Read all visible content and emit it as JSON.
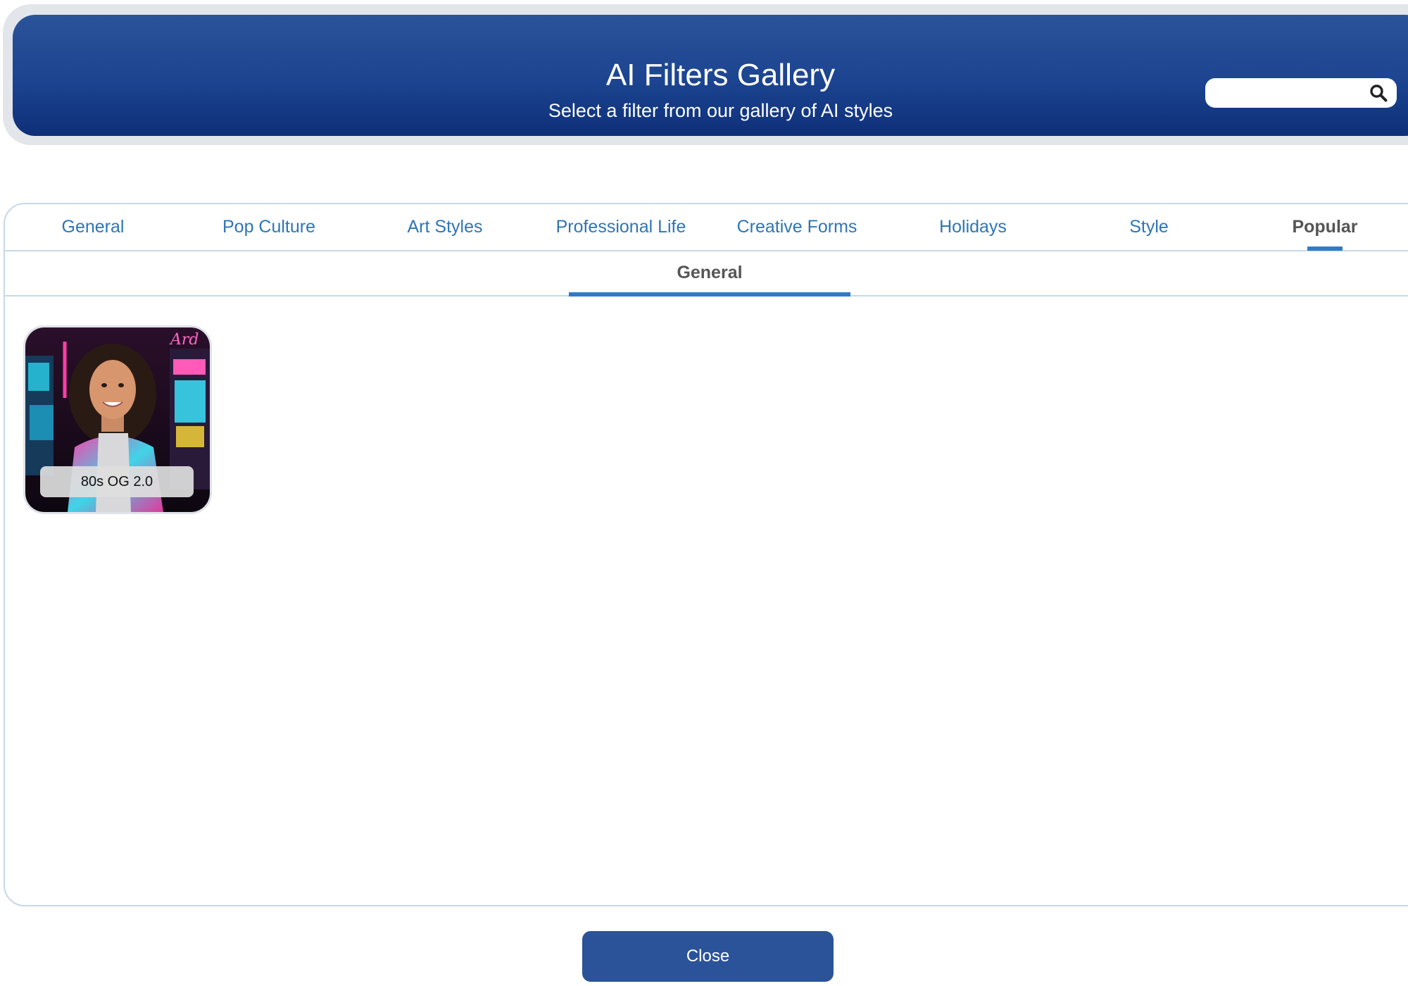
{
  "header": {
    "title": "AI Filters Gallery",
    "subtitle": "Select a filter from our gallery of AI styles",
    "search": {
      "value": "",
      "placeholder": "",
      "icon": "search-icon"
    }
  },
  "tabs": [
    {
      "label": "General",
      "active": false
    },
    {
      "label": "Pop Culture",
      "active": false
    },
    {
      "label": "Art Styles",
      "active": false
    },
    {
      "label": "Professional Life",
      "active": false
    },
    {
      "label": "Creative Forms",
      "active": false
    },
    {
      "label": "Holidays",
      "active": false
    },
    {
      "label": "Style",
      "active": false
    },
    {
      "label": "Popular",
      "active": true
    }
  ],
  "subtabs": [
    {
      "label": "General",
      "active": true
    }
  ],
  "filters": [
    {
      "label": "80s OG 2.0"
    }
  ],
  "close_label": "Close",
  "colors": {
    "header_top": "#2b5399",
    "header_bottom": "#0e2f78",
    "tab_text": "#2e75b6",
    "active_underline": "#2e7cc7",
    "close_button": "#2b5399"
  }
}
